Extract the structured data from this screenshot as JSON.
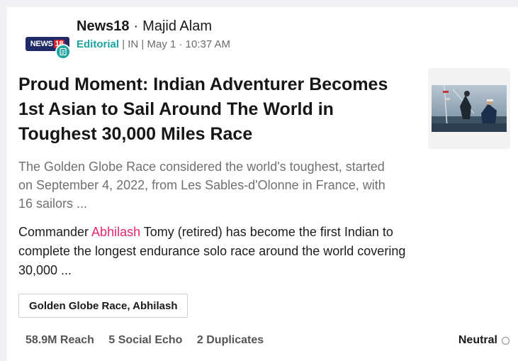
{
  "header": {
    "logo_text": "NEWS",
    "logo_number": "18",
    "source": "News18",
    "separator": "·",
    "author": "Majid Alam",
    "type": "Editorial",
    "meta": "| IN | May 1 · 10:37 AM"
  },
  "article": {
    "headline": "Proud Moment: Indian Adventurer Becomes 1st Asian to Sail Around The World in Toughest 30,000 Miles Race",
    "summary": "The Golden Globe Race considered the world's toughest, started on September 4, 2022, from Les Sables-d'Olonne in France, with 16 sailors ...",
    "body_prefix": "Commander ",
    "body_highlight": "Abhilash",
    "body_suffix": " Tomy (retired) has become the first Indian to complete the longest endurance solo race around the world covering 30,000 ..."
  },
  "tags": {
    "label": "Golden Globe Race, Abhilash"
  },
  "stats": {
    "reach": "58.9M Reach",
    "social_echo": "5 Social Echo",
    "duplicates": "2 Duplicates",
    "sentiment": "Neutral"
  },
  "colors": {
    "accent_teal": "#1aa3a1",
    "highlight_pink": "#e5266e",
    "logo_navy": "#1f2a66",
    "logo_red": "#d8232a"
  },
  "icons": {
    "publisher_logo": "news18-logo",
    "content_type": "document-icon",
    "sentiment": "circle-outline-icon"
  }
}
